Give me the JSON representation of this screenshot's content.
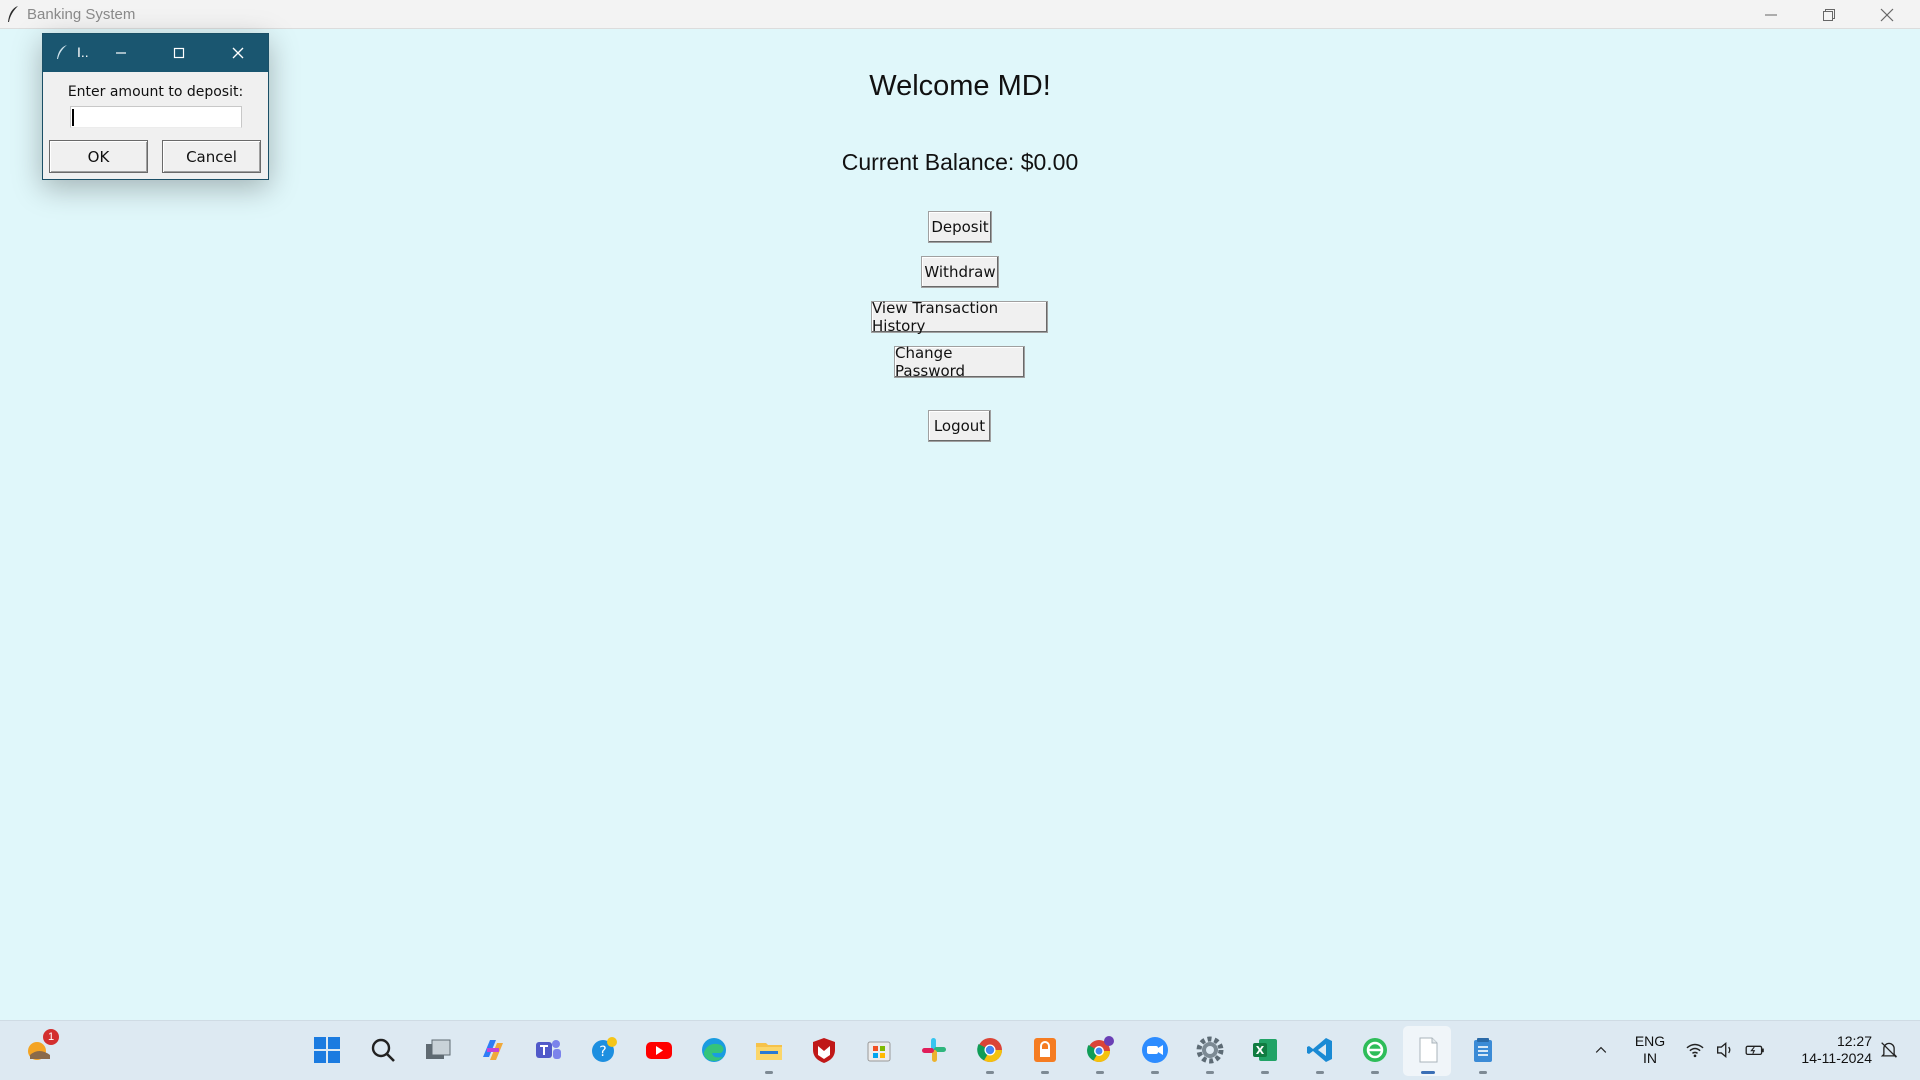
{
  "window": {
    "title": "Banking System"
  },
  "app": {
    "welcome": "Welcome MD!",
    "balance": "Current Balance: $0.00",
    "buttons": {
      "deposit": "Deposit",
      "withdraw": "Withdraw",
      "history": "View Transaction History",
      "change_password": "Change Password",
      "logout": "Logout"
    }
  },
  "dialog": {
    "title": "I..",
    "prompt": "Enter amount to deposit:",
    "input_value": "",
    "ok_label": "OK",
    "cancel_label": "Cancel"
  },
  "taskbar": {
    "widget_badge": "1",
    "language": "ENG",
    "region": "IN",
    "time": "12:27",
    "date": "14-11-2024",
    "icons": [
      "weather-widget-icon",
      "start-icon",
      "search-icon",
      "task-view-icon",
      "copilot-icon",
      "teams-icon",
      "help-icon",
      "youtube-icon",
      "edge-icon",
      "file-explorer-icon",
      "mcafee-icon",
      "store-icon",
      "slack-icon",
      "chrome-icon",
      "vpn-icon",
      "chrome-profile-icon",
      "zoom-icon",
      "settings-icon",
      "excel-icon",
      "vscode-icon",
      "app-green-icon",
      "notepad-icon",
      "notes-icon"
    ]
  },
  "colors": {
    "app_background": "#e0f7fa",
    "dialog_titlebar": "#1a5670",
    "taskbar": "#dde9f2"
  }
}
